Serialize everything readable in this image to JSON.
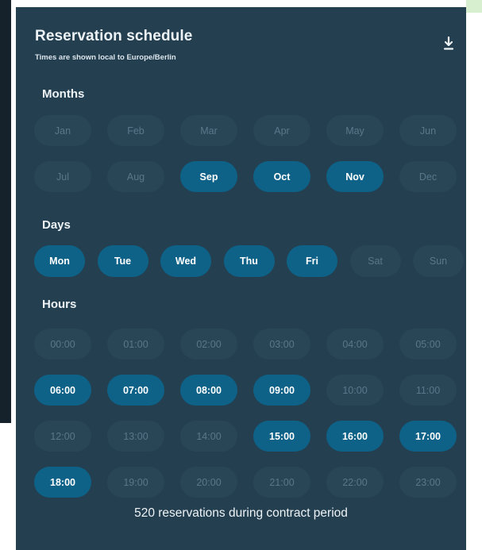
{
  "header": {
    "title": "Reservation schedule",
    "subtitle": "Times are shown local to Europe/Berlin"
  },
  "sections": {
    "months": "Months",
    "days": "Days",
    "hours": "Hours"
  },
  "months": [
    {
      "label": "Jan",
      "selected": false
    },
    {
      "label": "Feb",
      "selected": false
    },
    {
      "label": "Mar",
      "selected": false
    },
    {
      "label": "Apr",
      "selected": false
    },
    {
      "label": "May",
      "selected": false
    },
    {
      "label": "Jun",
      "selected": false
    },
    {
      "label": "Jul",
      "selected": false
    },
    {
      "label": "Aug",
      "selected": false
    },
    {
      "label": "Sep",
      "selected": true
    },
    {
      "label": "Oct",
      "selected": true
    },
    {
      "label": "Nov",
      "selected": true
    },
    {
      "label": "Dec",
      "selected": false
    }
  ],
  "days": [
    {
      "label": "Mon",
      "selected": true
    },
    {
      "label": "Tue",
      "selected": true
    },
    {
      "label": "Wed",
      "selected": true
    },
    {
      "label": "Thu",
      "selected": true
    },
    {
      "label": "Fri",
      "selected": true
    },
    {
      "label": "Sat",
      "selected": false
    },
    {
      "label": "Sun",
      "selected": false
    }
  ],
  "hours": [
    {
      "label": "00:00",
      "selected": false
    },
    {
      "label": "01:00",
      "selected": false
    },
    {
      "label": "02:00",
      "selected": false
    },
    {
      "label": "03:00",
      "selected": false
    },
    {
      "label": "04:00",
      "selected": false
    },
    {
      "label": "05:00",
      "selected": false
    },
    {
      "label": "06:00",
      "selected": true
    },
    {
      "label": "07:00",
      "selected": true
    },
    {
      "label": "08:00",
      "selected": true
    },
    {
      "label": "09:00",
      "selected": true
    },
    {
      "label": "10:00",
      "selected": false
    },
    {
      "label": "11:00",
      "selected": false
    },
    {
      "label": "12:00",
      "selected": false
    },
    {
      "label": "13:00",
      "selected": false
    },
    {
      "label": "14:00",
      "selected": false
    },
    {
      "label": "15:00",
      "selected": true
    },
    {
      "label": "16:00",
      "selected": true
    },
    {
      "label": "17:00",
      "selected": true
    },
    {
      "label": "18:00",
      "selected": true
    },
    {
      "label": "19:00",
      "selected": false
    },
    {
      "label": "20:00",
      "selected": false
    },
    {
      "label": "21:00",
      "selected": false
    },
    {
      "label": "22:00",
      "selected": false
    },
    {
      "label": "23:00",
      "selected": false
    }
  ],
  "footer": {
    "summary": "520 reservations during contract period"
  },
  "icons": {
    "download": "download-icon"
  },
  "colors": {
    "card_background": "#233f50",
    "selected_pill": "#0e6288",
    "unselected_pill": "#284656",
    "unselected_text": "#58788a",
    "text": "#eef3f6"
  }
}
